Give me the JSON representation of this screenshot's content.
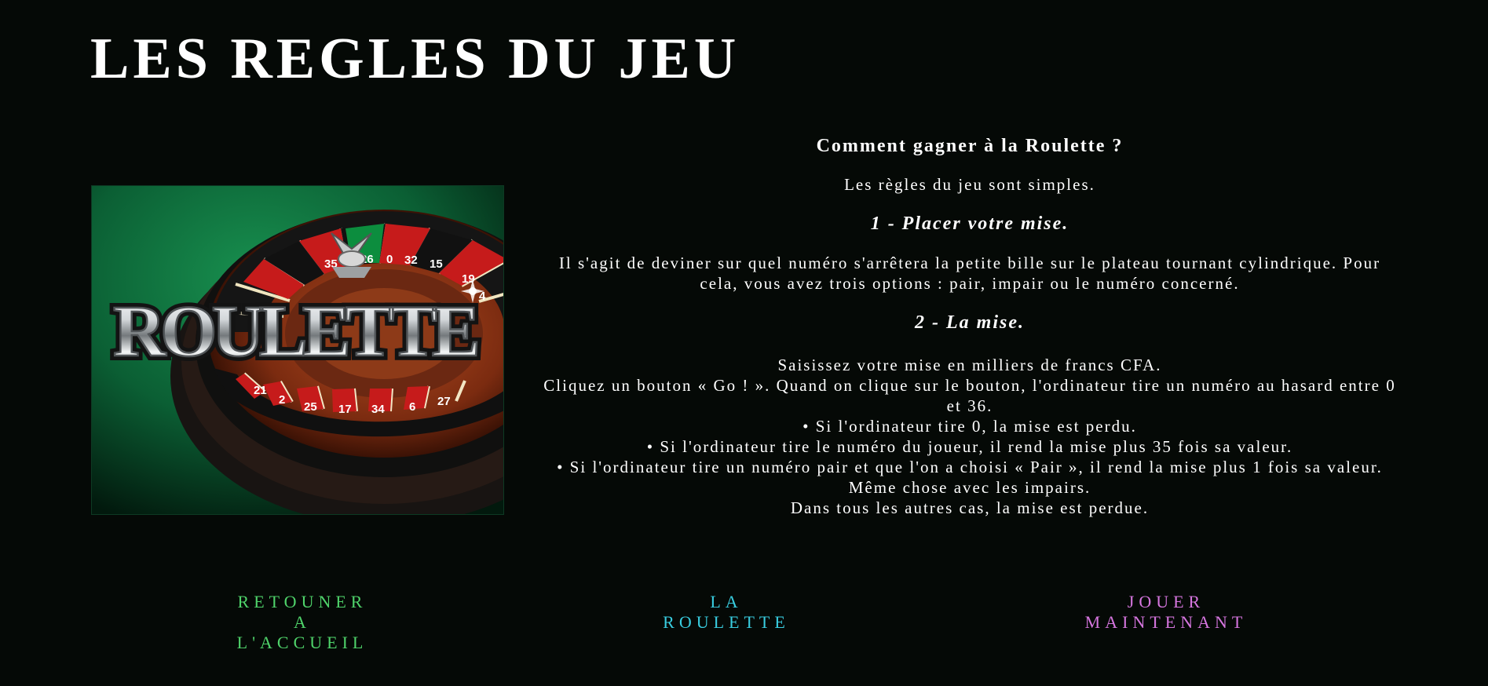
{
  "page": {
    "title": "LES REGLES DU JEU"
  },
  "image": {
    "alt": "Roulette",
    "logo_text": "ROULETTE",
    "wheel_numbers": [
      "35",
      "3",
      "26",
      "0",
      "32",
      "15",
      "19",
      "4",
      "21",
      "2",
      "25",
      "17",
      "34",
      "6",
      "27"
    ],
    "colors": {
      "table": "#0b5f34",
      "wheel": "#8b3615",
      "red_pocket": "#c61b1b",
      "black_pocket": "#111111",
      "green_pocket": "#0c8d3e"
    }
  },
  "rules": {
    "heading": "Comment gagner à la Roulette ?",
    "intro": "Les règles du jeu sont simples.",
    "step1_title": "1 - Placer votre mise.",
    "step1_text": "Il s'agit de deviner sur quel numéro s'arrêtera la petite bille sur le plateau tournant cylindrique. Pour cela, vous avez trois options : pair, impair ou le numéro concerné.",
    "step2_title": "2 - La mise.",
    "step2_lines": [
      "Saisissez votre mise en milliers de francs CFA.",
      "Cliquez un bouton « Go ! ». Quand on clique sur le bouton, l'ordinateur tire un numéro au hasard entre 0 et 36.",
      "• Si l'ordinateur tire 0, la mise est perdu.",
      "• Si l'ordinateur tire le numéro du joueur, il rend la mise plus 35 fois sa valeur.",
      "• Si l'ordinateur tire un numéro pair et que l'on a choisi « Pair », il rend la mise plus 1 fois sa valeur. Même chose avec les impairs.",
      "Dans tous les autres cas, la mise est perdue."
    ]
  },
  "nav": {
    "home": "RETOUNER\nA\nL'ACCUEIL",
    "roulette": "LA\nROULETTE",
    "play": "JOUER\nMAINTENANT",
    "colors": {
      "home": "#4fd36a",
      "roulette": "#39cde0",
      "play": "#d676df"
    }
  }
}
